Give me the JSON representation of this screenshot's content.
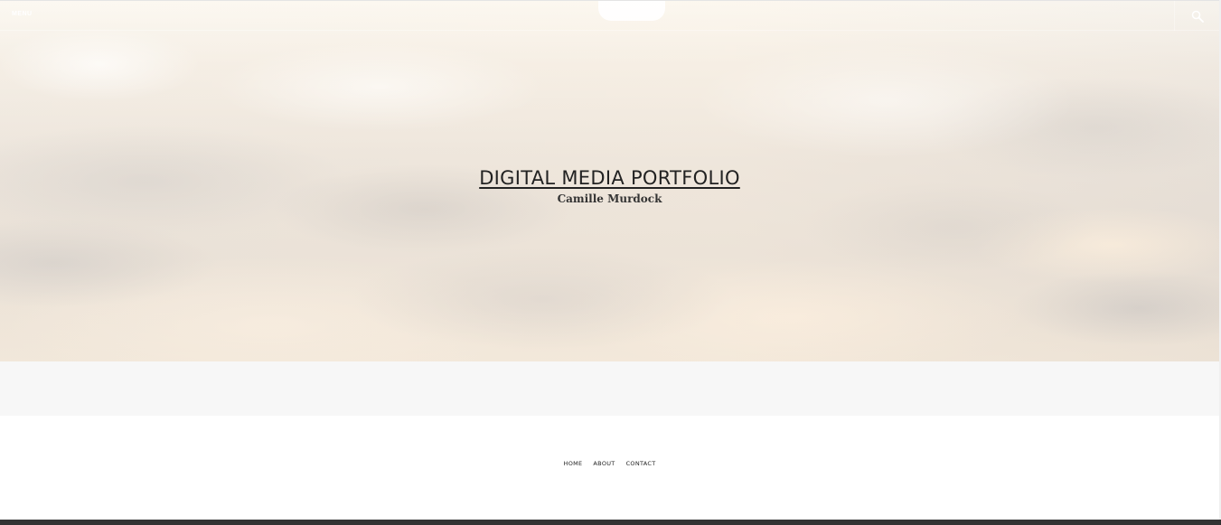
{
  "header": {
    "menu_label": "MENU",
    "search_icon": "search-icon"
  },
  "hero": {
    "site_title": "DIGITAL MEDIA PORTFOLIO",
    "site_description": "Camille Murdock"
  },
  "footer_nav": {
    "items": [
      {
        "label": "HOME"
      },
      {
        "label": "ABOUT"
      },
      {
        "label": "CONTACT"
      }
    ]
  },
  "colors": {
    "title_text": "#222222",
    "band_background": "#f7f7f7",
    "bottom_bar": "#333333"
  }
}
